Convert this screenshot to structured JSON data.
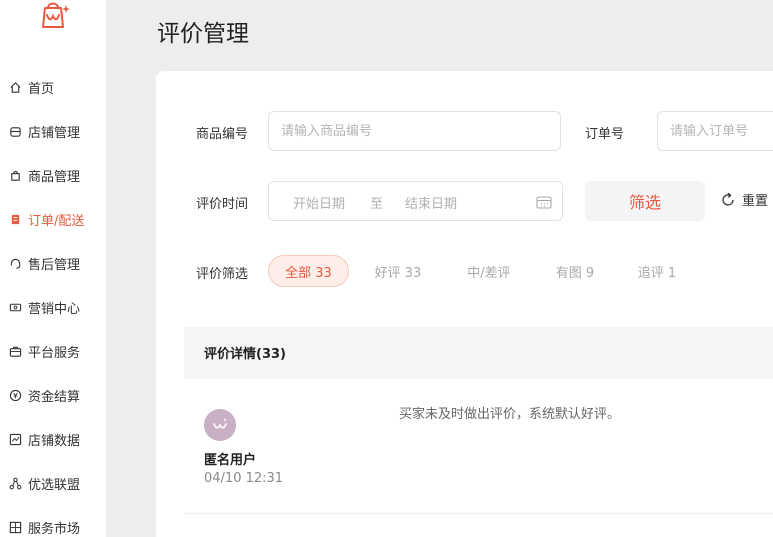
{
  "sidebar": {
    "items": [
      {
        "label": "首页",
        "icon": "home-icon"
      },
      {
        "label": "店铺管理",
        "icon": "store-icon"
      },
      {
        "label": "商品管理",
        "icon": "bag-icon"
      },
      {
        "label": "订单/配送",
        "icon": "order-icon",
        "active": true
      },
      {
        "label": "售后管理",
        "icon": "headset-icon"
      },
      {
        "label": "营销中心",
        "icon": "ticket-icon"
      },
      {
        "label": "平台服务",
        "icon": "briefcase-icon"
      },
      {
        "label": "资金结算",
        "icon": "coin-icon"
      },
      {
        "label": "店铺数据",
        "icon": "chart-icon"
      },
      {
        "label": "优选联盟",
        "icon": "network-icon"
      },
      {
        "label": "服务市场",
        "icon": "grid-icon"
      }
    ]
  },
  "page": {
    "title": "评价管理"
  },
  "filters": {
    "product_label": "商品编号",
    "product_placeholder": "请输入商品编号",
    "order_label": "订单号",
    "order_placeholder": "请输入订单号",
    "time_label": "评价时间",
    "start_placeholder": "开始日期",
    "to": "至",
    "end_placeholder": "结束日期",
    "filter_button": "筛选",
    "reset_button": "重置",
    "rating_label": "评价筛选"
  },
  "chips": [
    "全部 33",
    "好评 33",
    "中/差评",
    "有图 9",
    "追评 1"
  ],
  "detail": {
    "title": "评价详情(33)"
  },
  "review": {
    "username": "匿名用户",
    "time": "04/10 12:31",
    "text": "买家未及时做出评价，系统默认好评。"
  },
  "colors": {
    "accent": "#e85a3f",
    "background": "#ededed"
  }
}
